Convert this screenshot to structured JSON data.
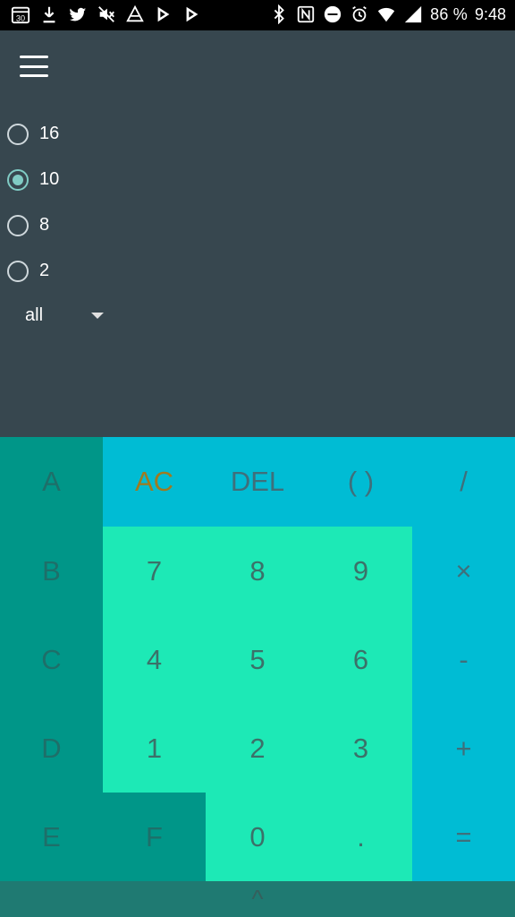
{
  "status_bar": {
    "left_icons": [
      "calendar-30-icon",
      "download-icon",
      "twitter-icon",
      "mute-icon",
      "nav-icon",
      "play-store-icon",
      "play-store-icon"
    ],
    "calendar_day": "30",
    "battery": "86 %",
    "time": "9:48"
  },
  "radios": [
    {
      "label": "16",
      "checked": false
    },
    {
      "label": "10",
      "checked": true
    },
    {
      "label": "8",
      "checked": false
    },
    {
      "label": "2",
      "checked": false
    }
  ],
  "dropdown": {
    "value": "all"
  },
  "keys": {
    "hex": [
      "A",
      "B",
      "C",
      "D",
      "E",
      "F"
    ],
    "ac": "AC",
    "del": "DEL",
    "paren": "( )",
    "div": "/",
    "mul": "×",
    "sub": "-",
    "add": "+",
    "eq": "=",
    "n7": "7",
    "n8": "8",
    "n9": "9",
    "n4": "4",
    "n5": "5",
    "n6": "6",
    "n1": "1",
    "n2": "2",
    "n3": "3",
    "n0": "0",
    "dot": "."
  },
  "bottom": {
    "label": "^"
  }
}
